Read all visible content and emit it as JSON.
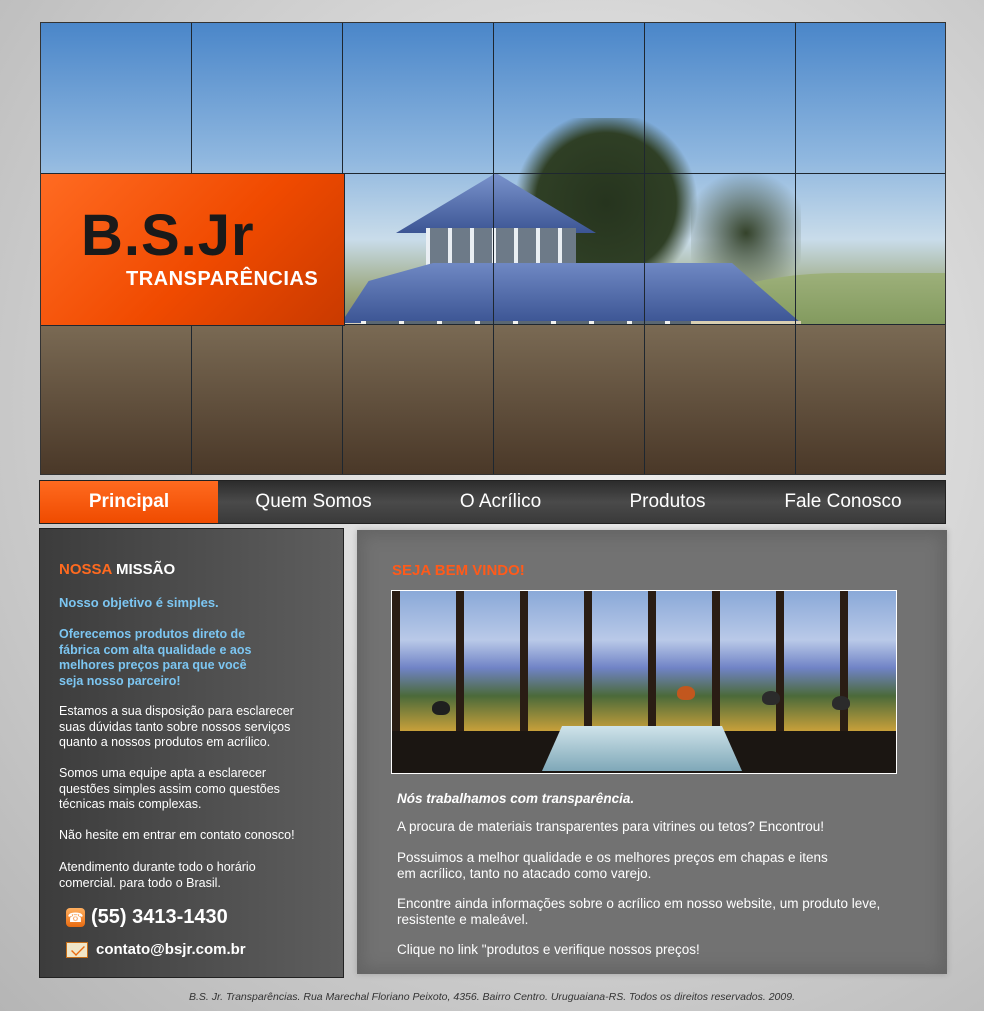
{
  "logo": {
    "main": "B.S.Jr",
    "sub": "TRANSPARÊNCIAS"
  },
  "nav": [
    {
      "label": "Principal",
      "active": true
    },
    {
      "label": "Quem Somos",
      "active": false
    },
    {
      "label": "O Acrílico",
      "active": false
    },
    {
      "label": "Produtos",
      "active": false
    },
    {
      "label": "Fale Conosco",
      "active": false
    }
  ],
  "left": {
    "title_orange": "NOSSA",
    "title_white": "MISSÃO",
    "objective": "Nosso objetivo é simples.",
    "offer": "Oferecemos produtos direto de fábrica com alta qualidade e aos melhores preços para que você seja nosso parceiro!",
    "p1": "Estamos a sua disposição para esclarecer suas dúvidas tanto sobre nossos serviços quanto a nossos produtos em acrílico.",
    "p2": "Somos uma equipe apta a esclarecer questões simples assim como questões técnicas mais complexas.",
    "p3": "Não hesite em entrar em contato conosco!",
    "p4": "Atendimento durante todo o horário comercial.  para todo o Brasil.",
    "phone": "(55) 3413-1430",
    "email": "contato@bsjr.com.br"
  },
  "right": {
    "welcome": "SEJA BEM VINDO!",
    "intro": "Nós trabalhamos com transparência.",
    "p1": "A procura de materiais transparentes para vitrines ou tetos? Encontrou!",
    "p2": "Possuimos a melhor qualidade e os melhores preços em chapas e itens em acrílico, tanto no atacado como varejo.",
    "p3": "Encontre ainda informações sobre o acrílico em nosso website, um produto leve, resistente e maleável.",
    "p4": "Clique no link \"produtos e verifique nossos preços!"
  },
  "footer": "B.S. Jr.  Transparências. Rua Marechal Floriano Peixoto, 4356. Bairro Centro. Uruguaiana-RS. Todos os direitos reservados. 2009.",
  "colors": {
    "accent": "#f04a00",
    "link_blue": "#7cc6f2",
    "welcome": "#ff5a1a"
  }
}
